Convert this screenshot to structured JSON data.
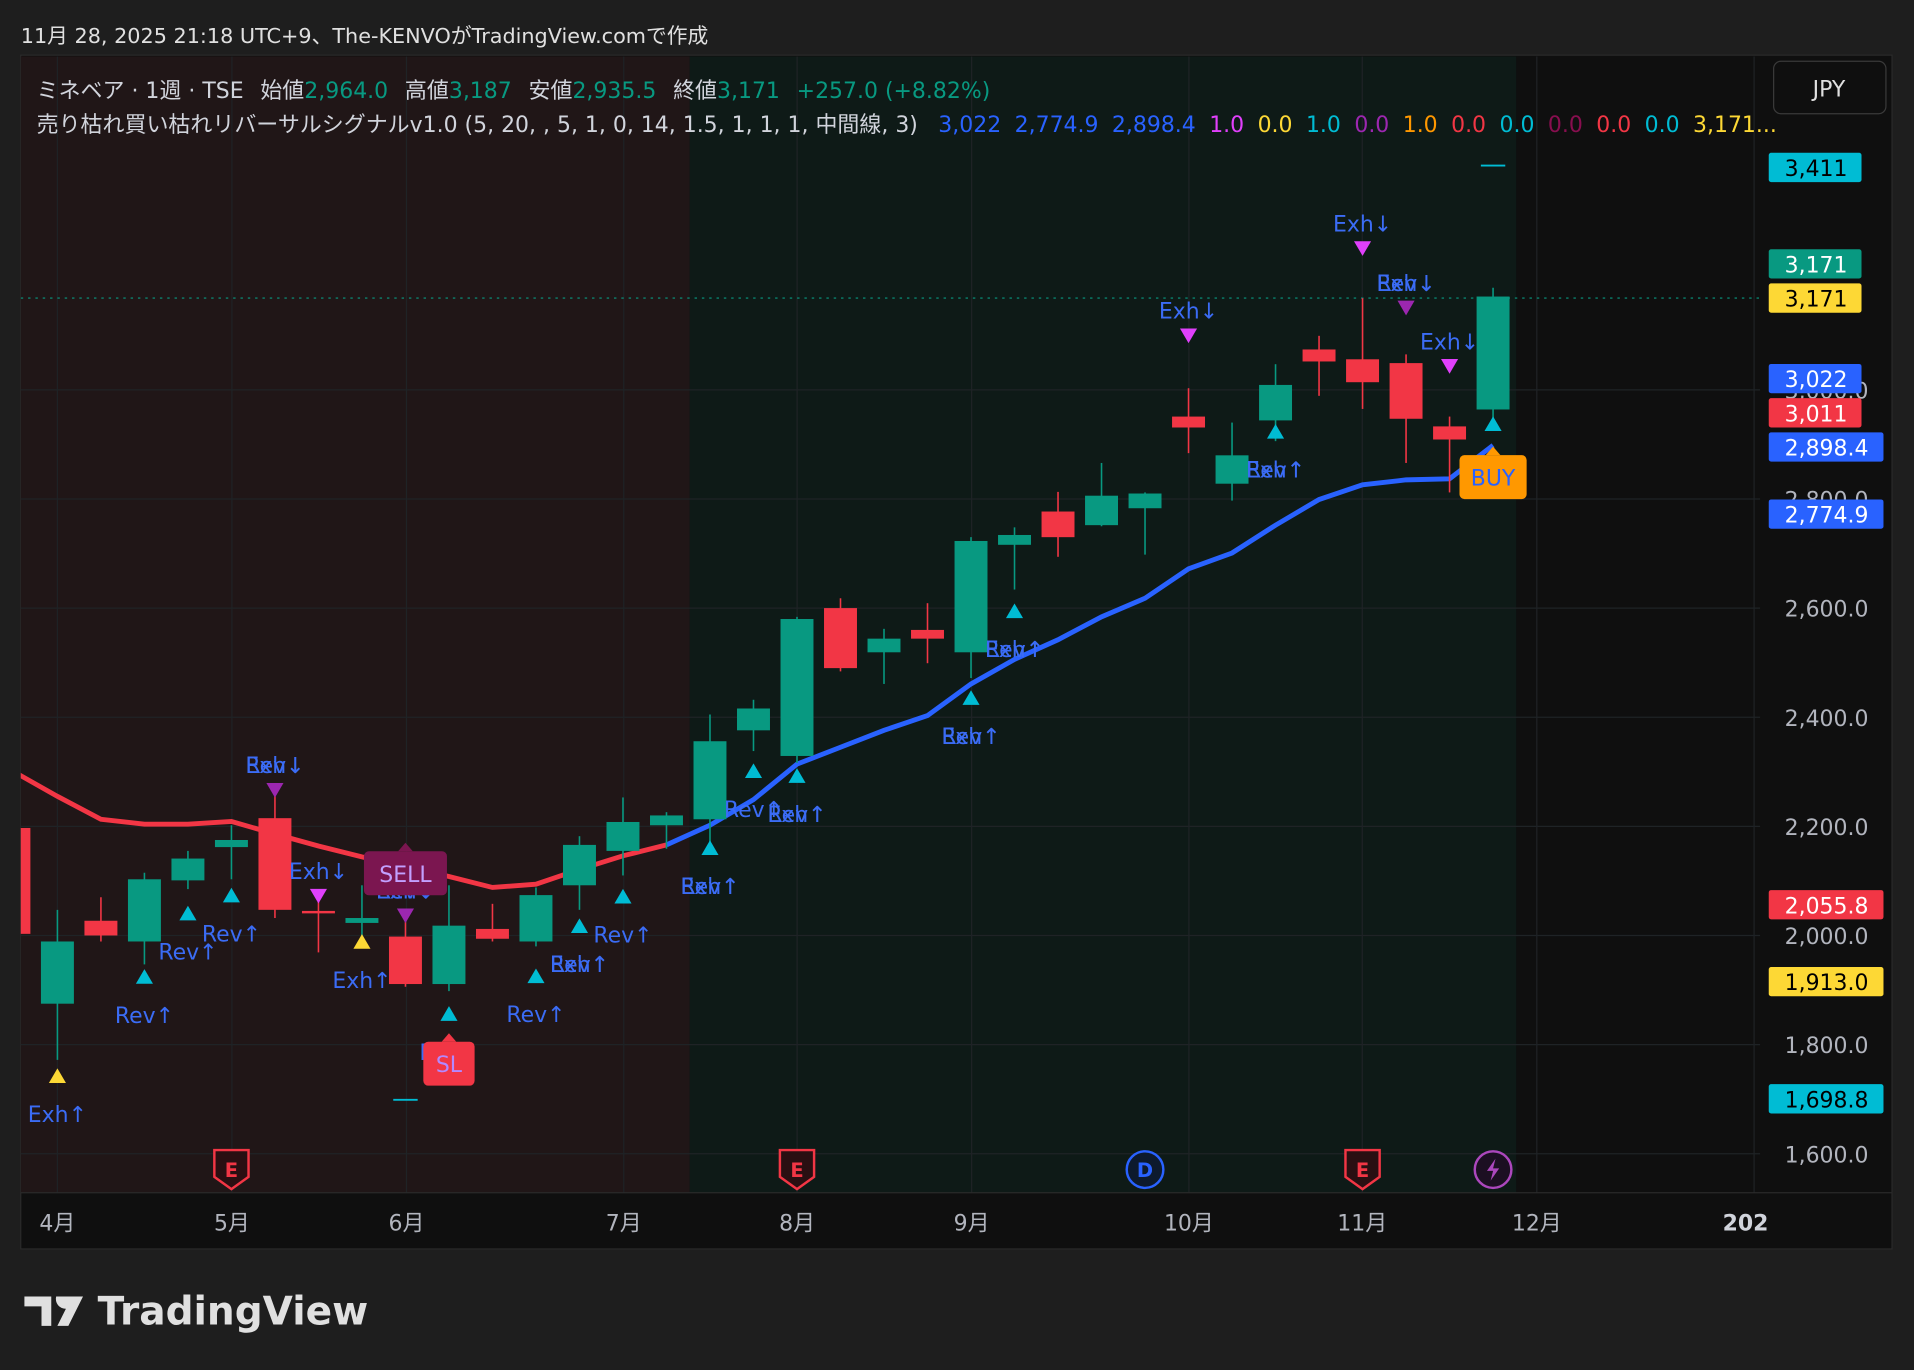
{
  "header": {
    "caption": "11月 28, 2025 21:18 UTC+9、The-KENVOがTradingView.comで作成"
  },
  "legend": {
    "symbol": "ミネベア · 1週 · TSE",
    "open_label": "始値",
    "open": "2,964.0",
    "high_label": "高値",
    "high": "3,187",
    "low_label": "安値",
    "low": "2,935.5",
    "close_label": "終値",
    "close": "3,171",
    "change": "+257.0 (+8.82%)",
    "indicator": "売り枯れ買い枯れリバーサルシグナルv1.0 (5, 20, , 5, 1, 0, 14, 1.5, 1, 1, 1, 中間線, 3)",
    "indicator_values": [
      {
        "text": "3,022",
        "color": "#2962ff"
      },
      {
        "text": "2,774.9",
        "color": "#2962ff"
      },
      {
        "text": "2,898.4",
        "color": "#2962ff"
      },
      {
        "text": "1.0",
        "color": "#e040fb"
      },
      {
        "text": "0.0",
        "color": "#fdd835"
      },
      {
        "text": "1.0",
        "color": "#00bcd4"
      },
      {
        "text": "0.0",
        "color": "#9c27b0"
      },
      {
        "text": "1.0",
        "color": "#ff9800"
      },
      {
        "text": "0.0",
        "color": "#f23645"
      },
      {
        "text": "0.0",
        "color": "#00bcd4"
      },
      {
        "text": "0.0",
        "color": "#880e4f"
      },
      {
        "text": "0.0",
        "color": "#f23645"
      },
      {
        "text": "0.0",
        "color": "#00bcd4"
      },
      {
        "text": "3,171...",
        "color": "#fdd835"
      }
    ]
  },
  "currency_button": "JPY",
  "colors": {
    "up": "#089981",
    "down": "#f23645",
    "line_up": "#2962ff",
    "line_down": "#f23645",
    "signal_text": "#3b6cf5"
  },
  "price_axis": {
    "ticks": [
      "1,600.0",
      "1,800.0",
      "2,000.0",
      "2,200.0",
      "2,400.0",
      "2,600.0",
      "2,800.0",
      "3,000.0"
    ],
    "tick_values": [
      1600,
      1800,
      2000,
      2200,
      2400,
      2600,
      2800,
      3000
    ]
  },
  "price_tags": [
    {
      "text": "3,411",
      "bg": "#00bcd4",
      "fg": "#000000"
    },
    {
      "text": "3,171",
      "bg": "#089981",
      "fg": "#ffffff"
    },
    {
      "text": "3,171",
      "bg": "#fdd835",
      "fg": "#000000"
    },
    {
      "text": "3,022",
      "bg": "#2962ff",
      "fg": "#ffffff"
    },
    {
      "text": "3,011",
      "bg": "#f23645",
      "fg": "#ffffff"
    },
    {
      "text": "2,898.4",
      "bg": "#2962ff",
      "fg": "#ffffff"
    },
    {
      "text": "2,774.9",
      "bg": "#2962ff",
      "fg": "#ffffff"
    },
    {
      "text": "2,055.8",
      "bg": "#f23645",
      "fg": "#ffffff"
    },
    {
      "text": "1,913.0",
      "bg": "#fdd835",
      "fg": "#000000"
    },
    {
      "text": "1,698.8",
      "bg": "#00bcd4",
      "fg": "#000000"
    }
  ],
  "time_axis": [
    "4月",
    "5月",
    "6月",
    "7月",
    "8月",
    "9月",
    "10月",
    "11月",
    "12月",
    "202"
  ],
  "candles": [
    [
      2197,
      2210,
      1995,
      2003
    ],
    [
      1875,
      2047,
      1772,
      1989
    ],
    [
      2027,
      2070,
      1989,
      2000
    ],
    [
      1989,
      2115,
      1947,
      2103
    ],
    [
      2101,
      2155,
      2085,
      2141
    ],
    [
      2162,
      2202,
      2103,
      2175
    ],
    [
      2215,
      2264,
      2032,
      2047
    ],
    [
      2045,
      2070,
      1969,
      2041
    ],
    [
      2023,
      2092,
      1991,
      2032
    ],
    [
      1998,
      2047,
      1906,
      1911
    ],
    [
      1911,
      2092,
      1898,
      2018
    ],
    [
      2012,
      2058,
      1989,
      1994
    ],
    [
      1989,
      2088,
      1980,
      2074
    ],
    [
      2092,
      2182,
      2047,
      2166
    ],
    [
      2155,
      2253,
      2110,
      2208
    ],
    [
      2202,
      2226,
      2159,
      2220
    ],
    [
      2213,
      2405,
      2170,
      2356
    ],
    [
      2376,
      2432,
      2338,
      2416
    ],
    [
      2329,
      2584,
      2316,
      2580
    ],
    [
      2600,
      2618,
      2484,
      2490
    ],
    [
      2519,
      2562,
      2461,
      2544
    ],
    [
      2560,
      2609,
      2499,
      2544
    ],
    [
      2519,
      2730,
      2472,
      2723
    ],
    [
      2716,
      2748,
      2634,
      2734
    ],
    [
      2777,
      2813,
      2694,
      2730
    ],
    [
      2752,
      2866,
      2750,
      2806
    ],
    [
      2783,
      2812,
      2698,
      2810
    ],
    [
      2951,
      3003,
      2884,
      2931
    ],
    [
      2828,
      2940,
      2797,
      2880
    ],
    [
      2944,
      3047,
      2906,
      3009
    ],
    [
      3074,
      3099,
      2989,
      3052
    ],
    [
      3056,
      3168,
      2965,
      3014
    ],
    [
      3049,
      3065,
      2866,
      2947
    ],
    [
      2933,
      2951,
      2812,
      2909
    ],
    [
      2964,
      3187,
      2935.5,
      3171
    ]
  ],
  "trend_line": [
    2300,
    2255,
    2213,
    2204,
    2204,
    2209,
    2186,
    2164,
    2144,
    2126,
    2108,
    2088,
    2094,
    2121,
    2146,
    2166,
    2202,
    2249,
    2314,
    2345,
    2376,
    2403,
    2461,
    2506,
    2542,
    2584,
    2618,
    2672,
    2701,
    2752,
    2799,
    2826,
    2835,
    2837,
    2898.4
  ],
  "trend_switch_index": 15,
  "signals": [
    {
      "i": 1,
      "dir": "up",
      "color": "#fdd835",
      "price": 1743,
      "labels": [
        "Exh↑"
      ]
    },
    {
      "i": 3,
      "dir": "up",
      "color": "#00bcd4",
      "price": 1925,
      "labels": [
        "Rev↑"
      ]
    },
    {
      "i": 4,
      "dir": "up",
      "color": "#00bcd4",
      "price": 2041,
      "labels": [
        "Rev↑"
      ]
    },
    {
      "i": 5,
      "dir": "up",
      "color": "#00bcd4",
      "price": 2074,
      "labels": [
        "Rev↑"
      ]
    },
    {
      "i": 6,
      "dir": "down",
      "color": "#9c27b0",
      "price": 2266,
      "labels": [
        "Rev↓",
        "Exh↓"
      ]
    },
    {
      "i": 7,
      "dir": "down",
      "color": "#e040fb",
      "price": 2072,
      "labels": [
        "Exh↓"
      ]
    },
    {
      "i": 8,
      "dir": "up",
      "color": "#fdd835",
      "price": 1989,
      "labels": [
        "Exh↑"
      ]
    },
    {
      "i": 9,
      "dir": "down",
      "color": "#9c27b0",
      "price": 2036,
      "labels": [
        "Rev↓",
        "Exh↓"
      ]
    },
    {
      "i": 10,
      "dir": "up",
      "color": "#00bcd4",
      "price": 1857,
      "labels": [
        "Rev↑"
      ]
    },
    {
      "i": 12,
      "dir": "up",
      "color": "#00bcd4",
      "price": 1926,
      "labels": [
        "Rev↑"
      ]
    },
    {
      "i": 13,
      "dir": "up",
      "color": "#00bcd4",
      "price": 2018,
      "labels": [
        "Rev↑",
        "Exh↑"
      ]
    },
    {
      "i": 14,
      "dir": "up",
      "color": "#00bcd4",
      "price": 2072,
      "labels": [
        "Rev↑"
      ]
    },
    {
      "i": 16,
      "dir": "up",
      "color": "#00bcd4",
      "price": 2161,
      "labels": [
        "Rev↑",
        "Exh↑"
      ]
    },
    {
      "i": 17,
      "dir": "up",
      "color": "#00bcd4",
      "price": 2302,
      "labels": [
        "Rev↑"
      ]
    },
    {
      "i": 18,
      "dir": "up",
      "color": "#00bcd4",
      "price": 2293,
      "labels": [
        "Rev↑",
        "Exh↑"
      ]
    },
    {
      "i": 22,
      "dir": "up",
      "color": "#00bcd4",
      "price": 2436,
      "labels": [
        "Rev↑",
        "Exh↑"
      ]
    },
    {
      "i": 23,
      "dir": "up",
      "color": "#00bcd4",
      "price": 2595,
      "labels": [
        "Rev↑",
        "Exh↑"
      ]
    },
    {
      "i": 27,
      "dir": "down",
      "color": "#e040fb",
      "price": 3099,
      "labels": [
        "Exh↓"
      ]
    },
    {
      "i": 29,
      "dir": "up",
      "color": "#00bcd4",
      "price": 2924,
      "labels": [
        "Rev↑",
        "Exh↑"
      ]
    },
    {
      "i": 31,
      "dir": "down",
      "color": "#e040fb",
      "price": 3259,
      "labels": [
        "Exh↓"
      ]
    },
    {
      "i": 32,
      "dir": "down",
      "color": "#9c27b0",
      "price": 3150,
      "labels": [
        "Rev↓",
        "Exh↓"
      ]
    },
    {
      "i": 33,
      "dir": "down",
      "color": "#e040fb",
      "price": 3043,
      "labels": [
        "Exh↓"
      ]
    },
    {
      "i": 34,
      "dir": "up",
      "color": "#00bcd4",
      "price": 2938,
      "labels": []
    }
  ],
  "badges": [
    {
      "i": 9,
      "text": "SELL",
      "bg": "#7b1650",
      "fg": "#c2a0ff",
      "price": 2114
    },
    {
      "i": 10,
      "text": "SL",
      "bg": "#f23645",
      "fg": "#b388ff",
      "price": 1765
    },
    {
      "i": 34,
      "text": "BUY",
      "bg": "#ff9800",
      "fg": "#2962ff",
      "price": 2840
    }
  ],
  "level_marks": [
    {
      "i": 34,
      "price": 3411
    },
    {
      "i": 9,
      "price": 1698.8
    }
  ],
  "events": [
    {
      "i": 5,
      "type": "E"
    },
    {
      "i": 18,
      "type": "E"
    },
    {
      "i": 26,
      "type": "D"
    },
    {
      "i": 31,
      "type": "E"
    },
    {
      "i": 34,
      "type": "lightning"
    }
  ],
  "footer": {
    "logo_text": "TradingView"
  }
}
